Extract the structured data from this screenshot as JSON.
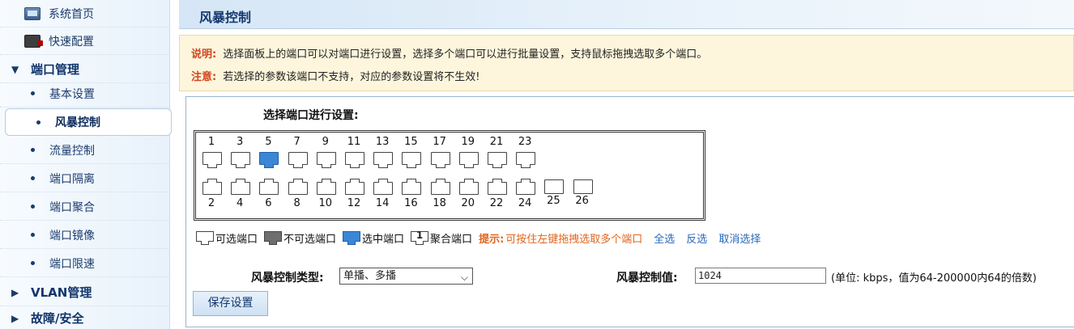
{
  "sidebar": {
    "home": "系统首页",
    "quick_config": "快速配置",
    "port_mgmt": "端口管理",
    "items": [
      "基本设置",
      "风暴控制",
      "流量控制",
      "端口隔离",
      "端口聚合",
      "端口镜像",
      "端口限速"
    ],
    "active_item": "风暴控制",
    "vlan_mgmt": "VLAN管理",
    "fault_security": "故障/安全"
  },
  "header": {
    "title": "风暴控制"
  },
  "info": {
    "note_key": "说明:",
    "note_text": "选择面板上的端口可以对端口进行设置，选择多个端口可以进行批量设置，支持鼠标拖拽选取多个端口。",
    "warn_key": "注意:",
    "warn_text": "若选择的参数该端口不支持，对应的参数设置将不生效!"
  },
  "panel": {
    "select_title": "选择端口进行设置:",
    "ports_top": [
      "1",
      "3",
      "5",
      "7",
      "9",
      "11",
      "13",
      "15",
      "17",
      "19",
      "21",
      "23"
    ],
    "ports_bottom": [
      "2",
      "4",
      "6",
      "8",
      "10",
      "12",
      "14",
      "16",
      "18",
      "20",
      "22",
      "24"
    ],
    "ports_fiber": [
      "25",
      "26"
    ],
    "selected_ports": [
      "5"
    ]
  },
  "legend": {
    "selectable": "可选端口",
    "unselectable": "不可选端口",
    "selected": "选中端口",
    "aggregated_digit": "1",
    "aggregated": "聚合端口",
    "hint_key": "提示:",
    "hint": "可按住左键拖拽选取多个端口",
    "select_all": "全选",
    "invert": "反选",
    "deselect": "取消选择"
  },
  "controls": {
    "type_label": "风暴控制类型:",
    "type_value": "单播、多播",
    "value_label": "风暴控制值:",
    "value": "1024",
    "unit": "(单位: kbps，值为64-200000内64的倍数)",
    "save": "保存设置"
  },
  "colors": {
    "selected_port": "#3c86d6",
    "hint": "#e0651d",
    "link": "#2a68b8",
    "note_key": "#d2461f"
  }
}
